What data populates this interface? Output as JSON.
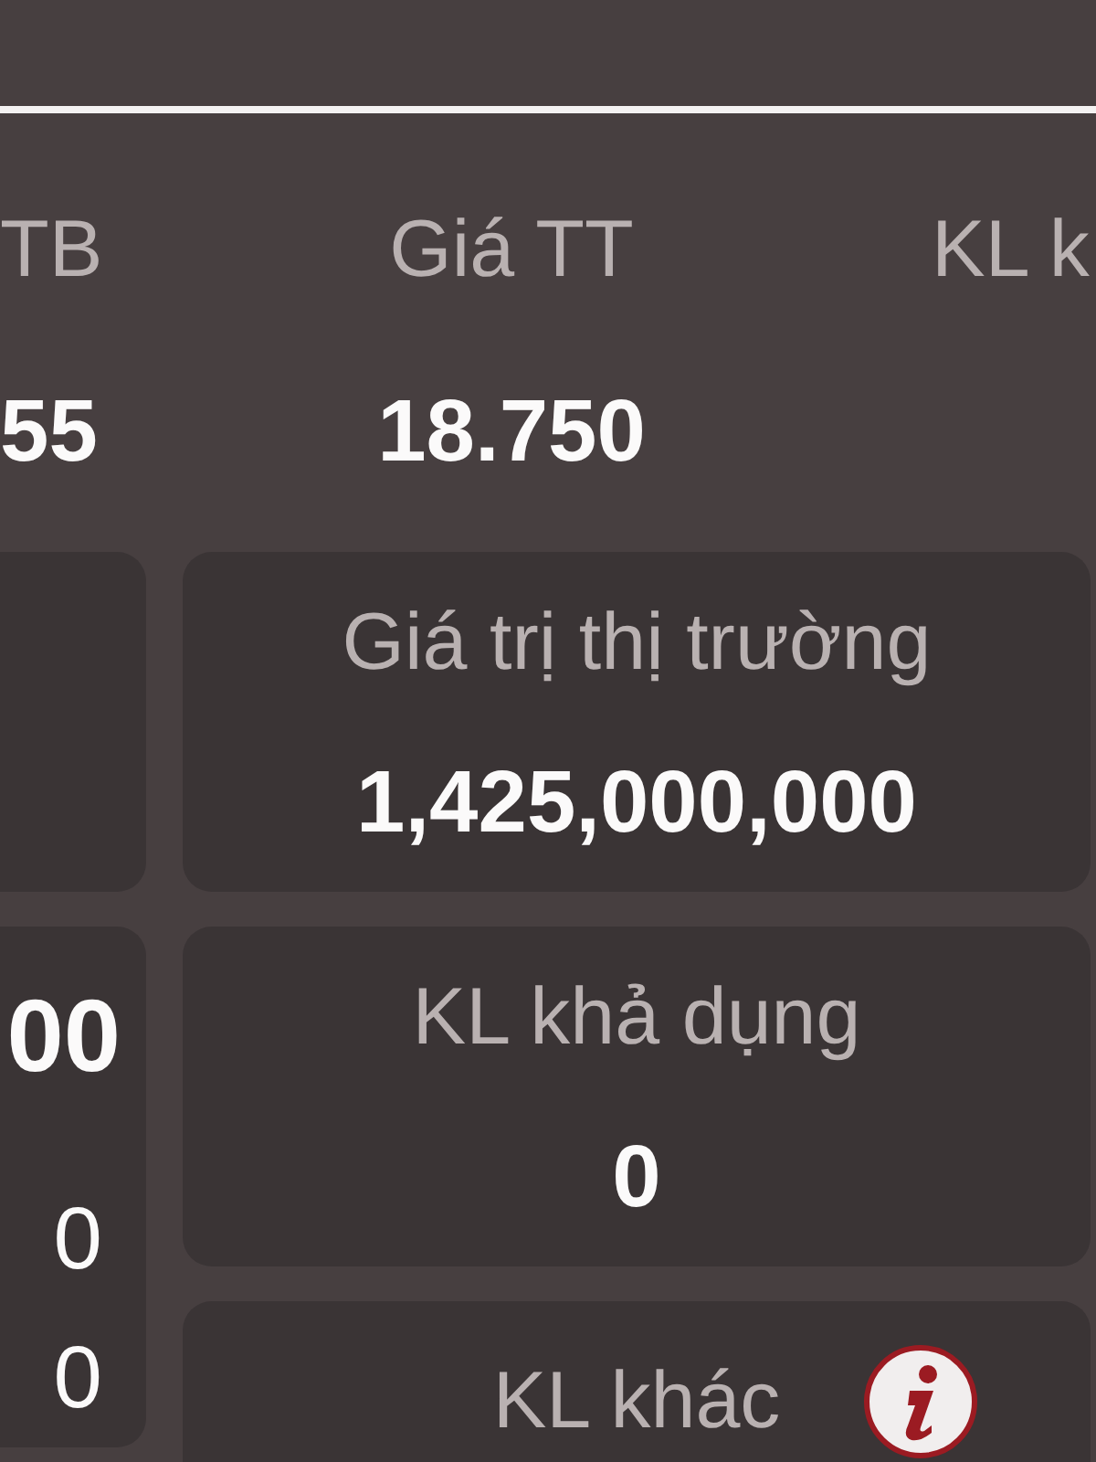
{
  "summary_columns": [
    {
      "label": "TB",
      "value": "55"
    },
    {
      "label": "Giá TT",
      "value": "18.750"
    },
    {
      "label": "KL k"
    }
  ],
  "left_cards": [
    {
      "kind": "blank"
    },
    {
      "kind": "figures",
      "value": "00",
      "rows": [
        "0",
        "0"
      ]
    }
  ],
  "cards": [
    {
      "label": "Giá trị thị trường",
      "value": "1,425,000,000",
      "info": false
    },
    {
      "label": "KL khả dụng",
      "value": "0",
      "info": false
    },
    {
      "label": "KL khác",
      "info": true
    }
  ]
}
